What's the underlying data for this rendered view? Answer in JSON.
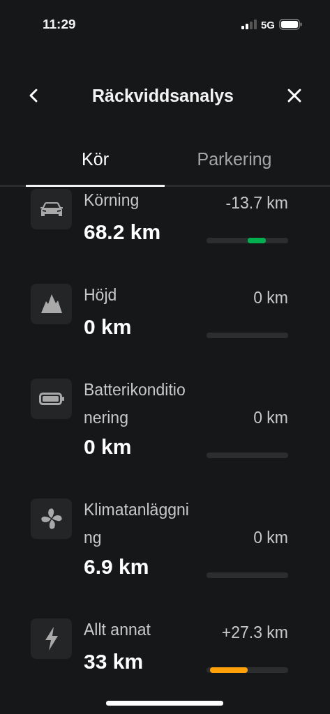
{
  "status_bar": {
    "time": "11:29",
    "network": "5G"
  },
  "header": {
    "title": "Räckviddsanalys"
  },
  "tabs": [
    {
      "label": "Kör",
      "selected": true
    },
    {
      "label": "Parkering",
      "selected": false
    }
  ],
  "factors": [
    {
      "label": "Körning",
      "value": "68.2 km",
      "delta": "-13.7 km",
      "kind": "right",
      "color": "#00b050"
    },
    {
      "label": "Höjd",
      "value": "0 km",
      "delta": "0 km"
    },
    {
      "label": "Batterikonditionering",
      "value": "0 km",
      "delta": "0 km"
    },
    {
      "label": "Klimatanläggning",
      "value": "6.9 km",
      "delta": "0 km"
    },
    {
      "label": "Allt annat",
      "value": "33 km",
      "delta": "+27.3 km",
      "kind": "left",
      "color": "#ffa20a"
    }
  ]
}
